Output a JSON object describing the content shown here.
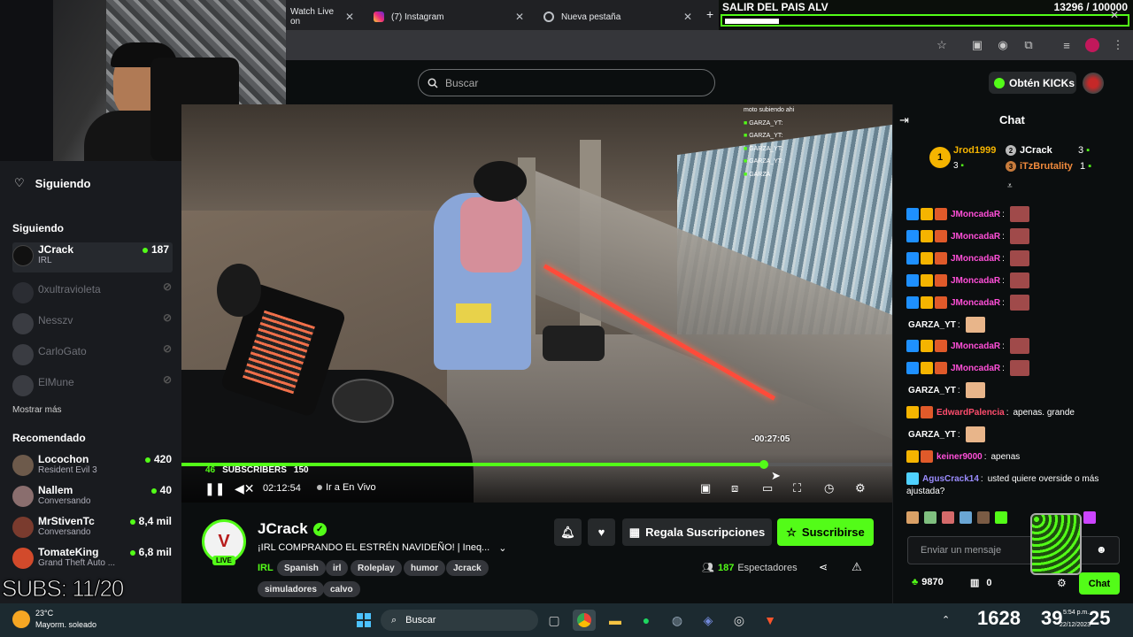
{
  "browser": {
    "tabs": [
      {
        "label": "Watch Live on"
      },
      {
        "label": "(7) Instagram"
      },
      {
        "label": "Nueva pestaña"
      }
    ],
    "new_tab_symbol": "+"
  },
  "goal": {
    "title": "SALIR DEL PAIS ALV",
    "progress_text": "13296 / 100000",
    "progress_fraction": 0.133
  },
  "header": {
    "search_placeholder": "Buscar",
    "kicks_label": "Obtén KICKs"
  },
  "sidebar": {
    "following_header": "Siguiendo",
    "following_section": "Siguiendo",
    "following": [
      {
        "name": "JCrack",
        "sub": "IRL",
        "count": "187",
        "live": true
      },
      {
        "name": "0xultravioleta",
        "live": false
      },
      {
        "name": "Nesszv",
        "live": false
      },
      {
        "name": "CarloGato",
        "live": false
      },
      {
        "name": "ElMune",
        "live": false
      }
    ],
    "show_more": "Mostrar más",
    "recommended_section": "Recomendado",
    "recommended": [
      {
        "name": "Locochon",
        "sub": "Resident Evil 3",
        "count": "420"
      },
      {
        "name": "Nallem",
        "sub": "Conversando",
        "count": "40"
      },
      {
        "name": "MrStivenTc",
        "sub": "Conversando",
        "count": "8,4 mil"
      },
      {
        "name": "TomateKing",
        "sub": "Grand Theft Auto ...",
        "count": "6,8 mil"
      }
    ]
  },
  "overlay": {
    "subs_text": "SUBS: 11/20",
    "subs_count_label": "46",
    "subscribers_label": "SUBSCRIBERS",
    "subscribers_value": "150"
  },
  "video": {
    "time_remaining": "-00:27:05",
    "current_time": "02:12:54",
    "go_live": "Ir a En Vivo",
    "seek_fraction": 0.82,
    "onscreen_chat": [
      "moto subiendo ahi",
      "GARZA_YT:",
      "GARZA_YT:",
      "GARZA_YT:",
      "GARZA_YT:",
      "GARZA"
    ]
  },
  "stream": {
    "channel": "JCrack",
    "title": "¡IRL COMPRANDO EL ESTRÉN NAVIDEÑO! | Ineq...",
    "category": "IRL",
    "tags": [
      "Spanish",
      "irl",
      "Roleplay",
      "humor",
      "Jcrack",
      "simuladores",
      "calvo"
    ],
    "live_badge": "LIVE",
    "viewers": "187",
    "viewers_label": "Espectadores",
    "gift_label": "Regala Suscripciones",
    "subscribe_label": "Suscribirse"
  },
  "chat": {
    "title": "Chat",
    "leaderboard": [
      {
        "rank": "1",
        "name": "Jrod1999",
        "count": "3"
      },
      {
        "rank": "2",
        "name": "JCrack",
        "count": "3"
      },
      {
        "rank": "3",
        "name": "iTzBrutality",
        "count": "1"
      }
    ],
    "messages": [
      {
        "user": "JMoncadaR",
        "text": "",
        "color": "#ff4fd8"
      },
      {
        "user": "JMoncadaR",
        "text": "",
        "color": "#ff4fd8"
      },
      {
        "user": "JMoncadaR",
        "text": "",
        "color": "#ff4fd8"
      },
      {
        "user": "JMoncadaR",
        "text": "",
        "color": "#ff4fd8"
      },
      {
        "user": "JMoncadaR",
        "text": "",
        "color": "#ff4fd8"
      },
      {
        "user": "GARZA_YT",
        "text": "",
        "color": "#ffffff"
      },
      {
        "user": "JMoncadaR",
        "text": "",
        "color": "#ff4fd8"
      },
      {
        "user": "JMoncadaR",
        "text": "",
        "color": "#ff4fd8"
      },
      {
        "user": "GARZA_YT",
        "text": "",
        "color": "#ffffff"
      },
      {
        "user": "EdwardPalencia",
        "text": "apenas. grande",
        "color": "#ff4d6d"
      },
      {
        "user": "GARZA_YT",
        "text": "",
        "color": "#ffffff"
      },
      {
        "user": "keiner9000",
        "text": "apenas",
        "color": "#ff4fd8"
      },
      {
        "user": "AgusCrack14",
        "text": "usted quiere overside o más",
        "color": "#9b8cff"
      }
    ],
    "last_line": "ajustada?",
    "input_placeholder": "Enviar un mensaje",
    "points": "9870",
    "extra_count": "0",
    "send_label": "Chat"
  },
  "taskbar": {
    "temp": "23°C",
    "weather": "Mayorm. soleado",
    "search_label": "Buscar",
    "clock_a": "1628",
    "clock_b": "39",
    "clock_c": "25",
    "clock_small": "5:54 p.m.",
    "date": "22/12/2023"
  },
  "colors": {
    "kick_green": "#53fc18",
    "background": "#0b0e0f",
    "sidebar": "#191b1f"
  }
}
